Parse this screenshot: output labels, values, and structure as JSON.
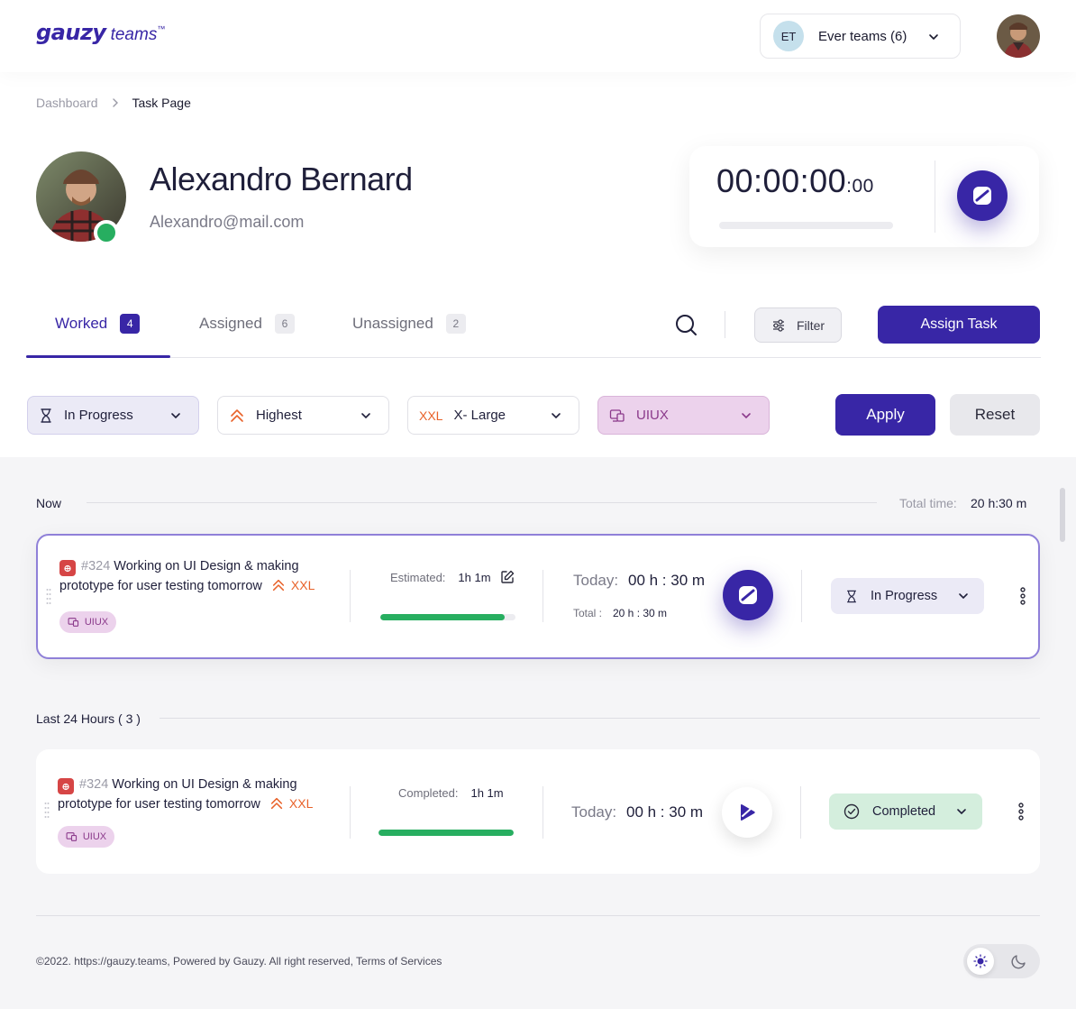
{
  "header": {
    "logo_main": "gauzy",
    "logo_sub": "teams",
    "logo_tm": "™",
    "team_initials": "ET",
    "team_name": "Ever teams (6)"
  },
  "breadcrumb": {
    "items": [
      "Dashboard"
    ],
    "current": "Task Page"
  },
  "profile": {
    "name": "Alexandro Bernard",
    "email": "Alexandro@mail.com",
    "status": "online"
  },
  "timer": {
    "time": "00:00:00",
    "ms": ":00"
  },
  "tabs": [
    {
      "label": "Worked",
      "count": "4",
      "active": true
    },
    {
      "label": "Assigned",
      "count": "6",
      "active": false
    },
    {
      "label": "Unassigned",
      "count": "2",
      "active": false
    }
  ],
  "toolbar": {
    "filter_label": "Filter",
    "assign_label": "Assign Task"
  },
  "filters": {
    "status": "In Progress",
    "priority": "Highest",
    "size_code": "XXL",
    "size": "X- Large",
    "label": "UIUX",
    "apply_label": "Apply",
    "reset_label": "Reset"
  },
  "sections": {
    "now": {
      "title": "Now",
      "total_label": "Total time:",
      "total_value": "20 h:30 m"
    },
    "last24": {
      "title": "Last 24 Hours ( 3 )"
    }
  },
  "tasks": [
    {
      "number": "#324",
      "title": "Working on UI Design & making prototype for user testing tomorrow",
      "size": "XXL",
      "label": "UIUX",
      "est_label": "Estimated:",
      "est_value": "1h 1m",
      "progress": 0.92,
      "today_label": "Today:",
      "today_value": "00 h : 30 m",
      "total_label": "Total :",
      "total_value": "20 h : 30 m",
      "status": "In Progress"
    },
    {
      "number": "#324",
      "title": "Working on UI Design & making prototype for user testing tomorrow",
      "size": "XXL",
      "label": "UIUX",
      "est_label": "Completed:",
      "est_value": "1h 1m",
      "progress": 1.0,
      "today_label": "Today:",
      "today_value": "00 h : 30 m",
      "status": "Completed"
    }
  ],
  "footer": {
    "text": "©2022. https://gauzy.teams, Powered by Gauzy. All right reserved, Terms of Services"
  },
  "colors": {
    "primary": "#3826a6",
    "success": "#27ae60",
    "warning": "#e8622a",
    "label_bg": "#ecd2ec"
  }
}
